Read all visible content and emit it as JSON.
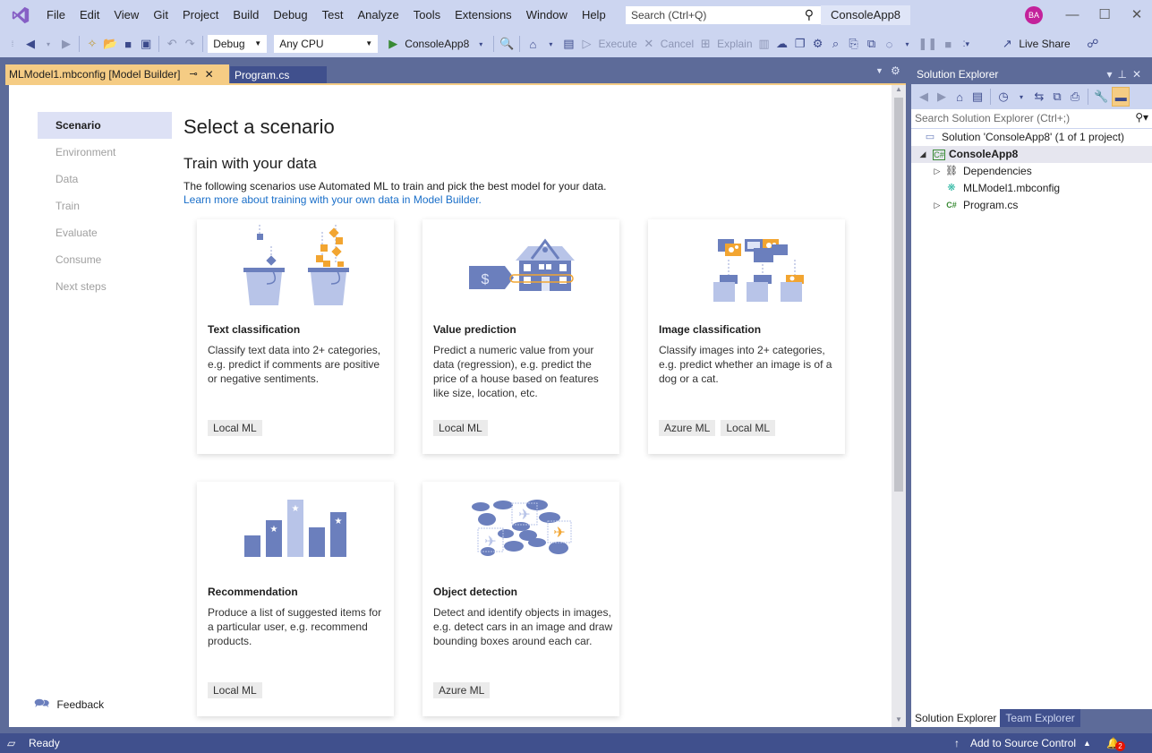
{
  "titlebar": {
    "menu": [
      "File",
      "Edit",
      "View",
      "Git",
      "Project",
      "Build",
      "Debug",
      "Test",
      "Analyze",
      "Tools",
      "Extensions",
      "Window",
      "Help"
    ],
    "search_placeholder": "Search (Ctrl+Q)",
    "project_name": "ConsoleApp8",
    "avatar_initials": "BA"
  },
  "toolbar": {
    "config": "Debug",
    "platform": "Any CPU",
    "start_label": "ConsoleApp8",
    "execute_label": "Execute",
    "cancel_label": "Cancel",
    "explain_label": "Explain",
    "live_share_label": "Live Share"
  },
  "tabs": {
    "active": "MLModel1.mbconfig [Model Builder]",
    "other": "Program.cs"
  },
  "steps": [
    "Scenario",
    "Environment",
    "Data",
    "Train",
    "Evaluate",
    "Consume",
    "Next steps"
  ],
  "active_step": "Scenario",
  "main": {
    "title": "Select a scenario",
    "subtitle": "Train with your data",
    "description": "The following scenarios use Automated ML to train and pick the best model for your data.",
    "learn_link": "Learn more about training with your own data in Model Builder."
  },
  "cards": [
    {
      "title": "Text classification",
      "desc": "Classify text data into 2+ categories, e.g. predict if comments are positive or negative sentiments.",
      "tags": [
        "Local ML"
      ]
    },
    {
      "title": "Value prediction",
      "desc": "Predict a numeric value from your data (regression), e.g. predict the price of a house based on features like size, location, etc.",
      "tags": [
        "Local ML"
      ]
    },
    {
      "title": "Image classification",
      "desc": "Classify images into 2+ categories, e.g. predict whether an image is of a dog or a cat.",
      "tags": [
        "Azure ML",
        "Local ML"
      ]
    },
    {
      "title": "Recommendation",
      "desc": "Produce a list of suggested items for a particular user, e.g. recommend products.",
      "tags": [
        "Local ML"
      ]
    },
    {
      "title": "Object detection",
      "desc": "Detect and identify objects in images, e.g. detect cars in an image and draw bounding boxes around each car.",
      "tags": [
        "Azure ML"
      ]
    }
  ],
  "feedback_label": "Feedback",
  "solution_explorer": {
    "title": "Solution Explorer",
    "search_placeholder": "Search Solution Explorer (Ctrl+;)",
    "solution": "Solution 'ConsoleApp8' (1 of 1 project)",
    "project": "ConsoleApp8",
    "items": [
      "Dependencies",
      "MLModel1.mbconfig",
      "Program.cs"
    ],
    "bottom_tabs": [
      "Solution Explorer",
      "Team Explorer"
    ]
  },
  "statusbar": {
    "status": "Ready",
    "source_control": "Add to Source Control",
    "notifications": "2"
  },
  "colors": {
    "chrome": "#ccd5f0",
    "frame": "#5d6b99",
    "active_tab": "#f5cc84",
    "statusbar": "#40508d",
    "link": "#1a6fc9",
    "illustration_primary": "#6b7fbd",
    "illustration_light": "#b8c4e8",
    "illustration_accent": "#f2a531"
  }
}
